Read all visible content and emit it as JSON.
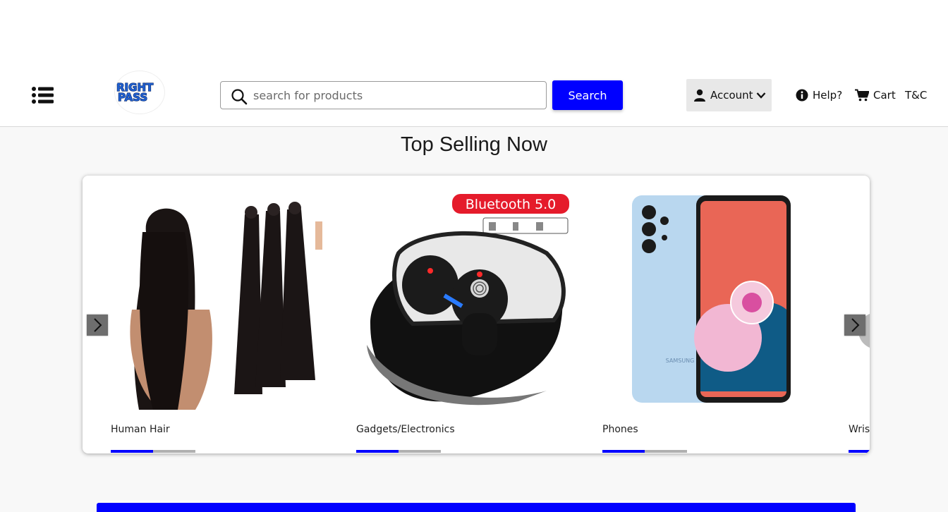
{
  "header": {
    "search_placeholder": "search for products",
    "search_button": "Search",
    "account_label": "Account",
    "help_label": "Help?",
    "cart_label": "Cart",
    "tnc_label": "T&C",
    "logo_text_line1": "RIGHT",
    "logo_text_line2": "PASS"
  },
  "section": {
    "title": "Top Selling Now"
  },
  "carousel": {
    "items": [
      {
        "label": "Human Hair",
        "icon": "hair-bundles-image",
        "progress": 0.5
      },
      {
        "label": "Gadgets/Electronics",
        "icon": "wireless-earbuds-image",
        "badge": "Bluetooth 5.0",
        "progress": 0.5
      },
      {
        "label": "Phones",
        "icon": "smartphone-image",
        "phone_brand": "SAMSUNG",
        "progress": 0.5
      },
      {
        "label": "Wris",
        "icon": "wristwatch-image",
        "progress": 0.5
      }
    ]
  },
  "colors": {
    "accent": "#0000ff",
    "progress_track": "#b0b0b0",
    "account_bg": "#e8e8e8",
    "page_bg": "#f8f8f8"
  }
}
